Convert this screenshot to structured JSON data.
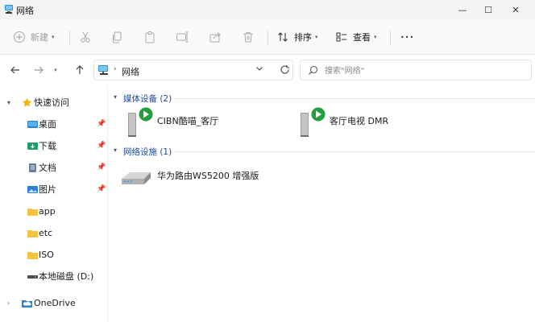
{
  "window": {
    "title": "网络",
    "minimize_glyph": "—",
    "maximize_glyph": "☐",
    "close_glyph": "✕"
  },
  "toolbar": {
    "new_label": "新建",
    "sort_label": "排序",
    "view_label": "查看",
    "more_glyph": "•••",
    "icons": [
      "plus-icon",
      "cut-icon",
      "copy-icon",
      "paste-icon",
      "rename-icon",
      "share-icon",
      "delete-icon",
      "sort-icon",
      "view-icon",
      "more-icon"
    ]
  },
  "nav": {
    "breadcrumb_sep": "›",
    "location": "网络",
    "search_placeholder": "搜索\"网络\""
  },
  "sidebar": {
    "quick_access": "快速访问",
    "items": [
      {
        "label": "桌面",
        "pinned": true
      },
      {
        "label": "下载",
        "pinned": true
      },
      {
        "label": "文档",
        "pinned": true
      },
      {
        "label": "图片",
        "pinned": true
      },
      {
        "label": "app",
        "pinned": false
      },
      {
        "label": "etc",
        "pinned": false
      },
      {
        "label": "ISO",
        "pinned": false
      },
      {
        "label": "本地磁盘 (D:)",
        "pinned": false
      }
    ],
    "onedrive": "OneDrive"
  },
  "content": {
    "groups": [
      {
        "title": "媒体设备 (2)",
        "devices": [
          {
            "name": "CIBN酷喵_客厅"
          },
          {
            "name": "客厅电视 DMR"
          }
        ]
      },
      {
        "title": "网络设施 (1)",
        "devices": [
          {
            "name": "华为路由WS5200 增强版"
          }
        ]
      }
    ]
  },
  "colors": {
    "accent": "#1f4aa0",
    "folder": "#f5c342",
    "play_green": "#22a03c"
  }
}
